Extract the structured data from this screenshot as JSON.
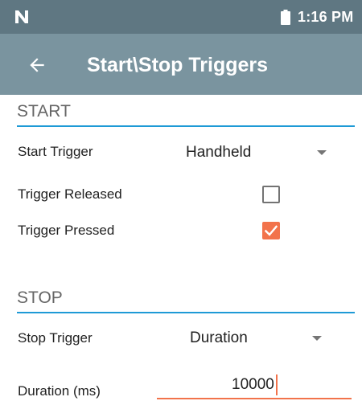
{
  "status_bar": {
    "logo_icon": "n-logo-icon",
    "battery_icon": "battery-full-icon",
    "time": "1:16 PM"
  },
  "app_bar": {
    "back_icon": "arrow-left-icon",
    "title": "Start\\Stop Triggers"
  },
  "start_section": {
    "header": "START",
    "start_trigger": {
      "label": "Start Trigger",
      "value": "Handheld"
    },
    "trigger_released": {
      "label": "Trigger Released",
      "checked": false
    },
    "trigger_pressed": {
      "label": "Trigger Pressed",
      "checked": true
    }
  },
  "stop_section": {
    "header": "STOP",
    "stop_trigger": {
      "label": "Stop Trigger",
      "value": "Duration"
    },
    "duration": {
      "label": "Duration (ms)",
      "value": "10000"
    }
  },
  "colors": {
    "status_bar": "#5f7782",
    "app_bar": "#7a949f",
    "section_underline": "#1e9ad6",
    "accent": "#f2734b"
  }
}
